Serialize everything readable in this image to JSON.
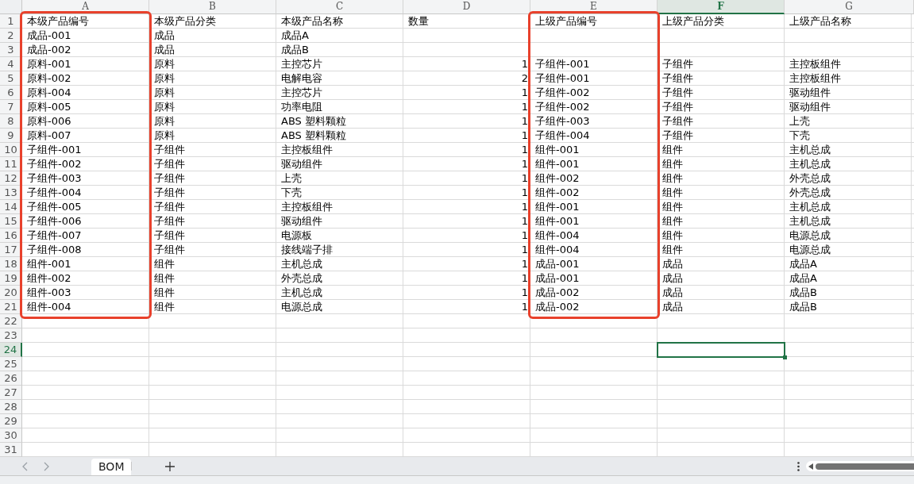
{
  "columns": [
    {
      "letter": "A",
      "selected": false,
      "framed": true
    },
    {
      "letter": "B",
      "selected": false,
      "framed": false
    },
    {
      "letter": "C",
      "selected": false,
      "framed": false
    },
    {
      "letter": "D",
      "selected": false,
      "framed": false
    },
    {
      "letter": "E",
      "selected": false,
      "framed": true
    },
    {
      "letter": "F",
      "selected": true,
      "framed": false
    },
    {
      "letter": "G",
      "selected": false,
      "framed": false
    }
  ],
  "rows": [
    {
      "number": "1",
      "selected": false,
      "text": {
        "A": "本级产品编号",
        "B": "本级产品分类",
        "C": "本级产品名称",
        "D": "数量",
        "E": "上级产品编号",
        "F": "上级产品分类",
        "G": "上级产品名称"
      }
    },
    {
      "number": "2",
      "selected": false,
      "text": {
        "A": "成品-001",
        "B": "成品",
        "C": "成品A"
      }
    },
    {
      "number": "3",
      "selected": false,
      "text": {
        "A": "成品-002",
        "B": "成品",
        "C": "成品B"
      }
    },
    {
      "number": "4",
      "selected": false,
      "text": {
        "A": "原料-001",
        "B": "原料",
        "C": "主控芯片",
        "E": "子组件-001",
        "F": "子组件",
        "G": "主控板组件"
      },
      "numbers": {
        "D": "1"
      }
    },
    {
      "number": "5",
      "selected": false,
      "text": {
        "A": "原料-002",
        "B": "原料",
        "C": "电解电容",
        "E": "子组件-001",
        "F": "子组件",
        "G": "主控板组件"
      },
      "numbers": {
        "D": "2"
      }
    },
    {
      "number": "6",
      "selected": false,
      "text": {
        "A": "原料-004",
        "B": "原料",
        "C": "主控芯片",
        "E": "子组件-002",
        "F": "子组件",
        "G": "驱动组件"
      },
      "numbers": {
        "D": "1"
      }
    },
    {
      "number": "7",
      "selected": false,
      "text": {
        "A": "原料-005",
        "B": "原料",
        "C": "功率电阻",
        "E": "子组件-002",
        "F": "子组件",
        "G": "驱动组件"
      },
      "numbers": {
        "D": "1"
      }
    },
    {
      "number": "8",
      "selected": false,
      "text": {
        "A": "原料-006",
        "B": "原料",
        "C": "ABS 塑料颗粒",
        "E": "子组件-003",
        "F": "子组件",
        "G": "上壳"
      },
      "numbers": {
        "D": "1"
      }
    },
    {
      "number": "9",
      "selected": false,
      "text": {
        "A": "原料-007",
        "B": "原料",
        "C": "ABS 塑料颗粒",
        "E": "子组件-004",
        "F": "子组件",
        "G": "下壳"
      },
      "numbers": {
        "D": "1"
      }
    },
    {
      "number": "10",
      "selected": false,
      "text": {
        "A": "子组件-001",
        "B": "子组件",
        "C": "主控板组件",
        "E": "组件-001",
        "F": "组件",
        "G": "主机总成"
      },
      "numbers": {
        "D": "1"
      }
    },
    {
      "number": "11",
      "selected": false,
      "text": {
        "A": "子组件-002",
        "B": "子组件",
        "C": "驱动组件",
        "E": "组件-001",
        "F": "组件",
        "G": "主机总成"
      },
      "numbers": {
        "D": "1"
      }
    },
    {
      "number": "12",
      "selected": false,
      "text": {
        "A": "子组件-003",
        "B": "子组件",
        "C": "上壳",
        "E": "组件-002",
        "F": "组件",
        "G": "外壳总成"
      },
      "numbers": {
        "D": "1"
      }
    },
    {
      "number": "13",
      "selected": false,
      "text": {
        "A": "子组件-004",
        "B": "子组件",
        "C": "下壳",
        "E": "组件-002",
        "F": "组件",
        "G": "外壳总成"
      },
      "numbers": {
        "D": "1"
      }
    },
    {
      "number": "14",
      "selected": false,
      "text": {
        "A": "子组件-005",
        "B": "子组件",
        "C": "主控板组件",
        "E": "组件-001",
        "F": "组件",
        "G": "主机总成"
      },
      "numbers": {
        "D": "1"
      }
    },
    {
      "number": "15",
      "selected": false,
      "text": {
        "A": "子组件-006",
        "B": "子组件",
        "C": "驱动组件",
        "E": "组件-001",
        "F": "组件",
        "G": "主机总成"
      },
      "numbers": {
        "D": "1"
      }
    },
    {
      "number": "16",
      "selected": false,
      "text": {
        "A": "子组件-007",
        "B": "子组件",
        "C": "电源板",
        "E": "组件-004",
        "F": "组件",
        "G": "电源总成"
      },
      "numbers": {
        "D": "1"
      }
    },
    {
      "number": "17",
      "selected": false,
      "text": {
        "A": "子组件-008",
        "B": "子组件",
        "C": "接线端子排",
        "E": "组件-004",
        "F": "组件",
        "G": "电源总成"
      },
      "numbers": {
        "D": "1"
      }
    },
    {
      "number": "18",
      "selected": false,
      "text": {
        "A": "组件-001",
        "B": "组件",
        "C": "主机总成",
        "E": "成品-001",
        "F": "成品",
        "G": "成品A"
      },
      "numbers": {
        "D": "1"
      }
    },
    {
      "number": "19",
      "selected": false,
      "text": {
        "A": "组件-002",
        "B": "组件",
        "C": "外壳总成",
        "E": "成品-001",
        "F": "成品",
        "G": "成品A"
      },
      "numbers": {
        "D": "1"
      }
    },
    {
      "number": "20",
      "selected": false,
      "text": {
        "A": "组件-003",
        "B": "组件",
        "C": "主机总成",
        "E": "成品-002",
        "F": "成品",
        "G": "成品B"
      },
      "numbers": {
        "D": "1"
      }
    },
    {
      "number": "21",
      "selected": false,
      "text": {
        "A": "组件-004",
        "B": "组件",
        "C": "电源总成",
        "E": "成品-002",
        "F": "成品",
        "G": "成品B"
      },
      "numbers": {
        "D": "1"
      }
    },
    {
      "number": "22",
      "selected": false
    },
    {
      "number": "23",
      "selected": false
    },
    {
      "number": "24",
      "selected": true
    },
    {
      "number": "25",
      "selected": false
    },
    {
      "number": "26",
      "selected": false
    },
    {
      "number": "27",
      "selected": false
    },
    {
      "number": "28",
      "selected": false
    },
    {
      "number": "29",
      "selected": false
    },
    {
      "number": "30",
      "selected": false
    },
    {
      "number": "31",
      "selected": false
    }
  ],
  "sheet_tabs": [
    {
      "label": "BOM",
      "selected": true
    }
  ]
}
